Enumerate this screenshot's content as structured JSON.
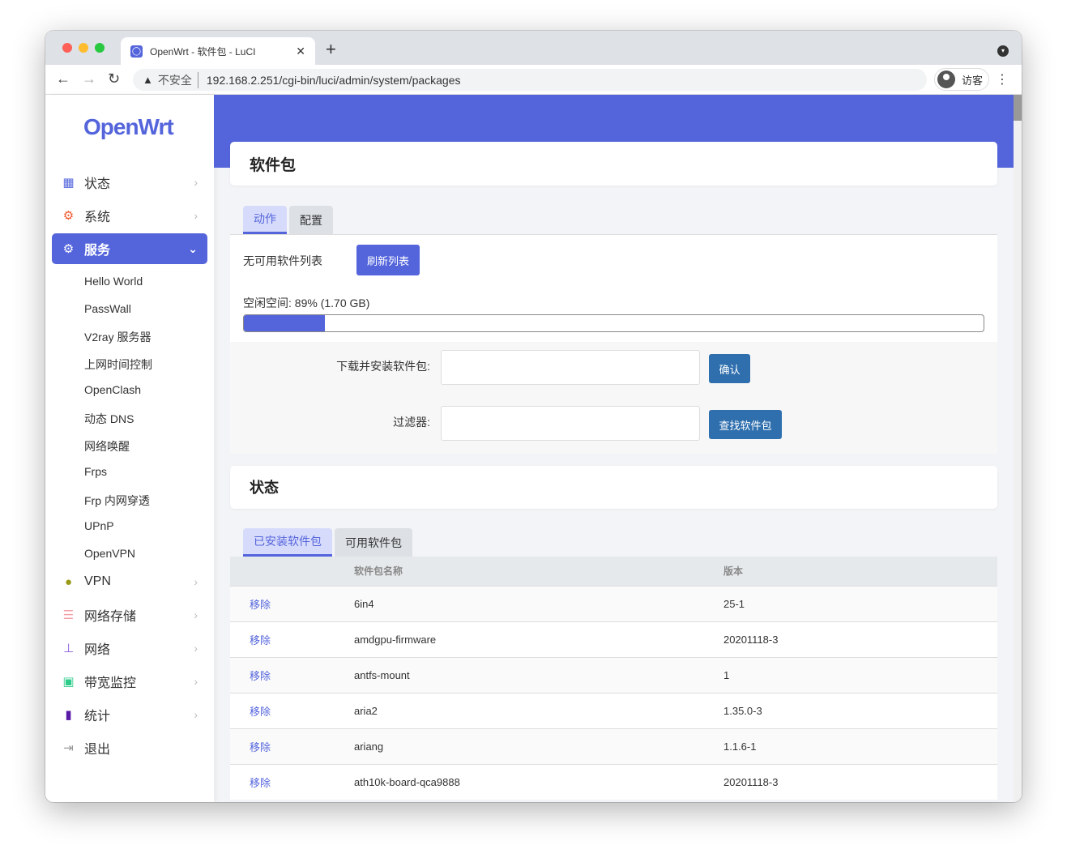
{
  "browser": {
    "tab_title": "OpenWrt - 软件包 - LuCI",
    "favicon": "openwrt-icon",
    "insecure_label": "不安全",
    "url": "192.168.2.251/cgi-bin/luci/admin/system/packages",
    "profile": "访客"
  },
  "sidebar": {
    "logo": "OpenWrt",
    "items": [
      {
        "label": "状态",
        "icon": "dashboard-icon",
        "color": "#5465dc"
      },
      {
        "label": "系统",
        "icon": "gear-icon",
        "color": "#f0582e"
      },
      {
        "label": "服务",
        "icon": "cogs-icon",
        "color": "#ffffff"
      },
      {
        "label": "VPN",
        "icon": "globe-lock-icon",
        "color": "#9a9a1a"
      },
      {
        "label": "网络存储",
        "icon": "database-icon",
        "color": "#f4a0aa"
      },
      {
        "label": "网络",
        "icon": "sitemap-icon",
        "color": "#8a5ce0"
      },
      {
        "label": "带宽监控",
        "icon": "monitor-icon",
        "color": "#2ecc8a"
      },
      {
        "label": "统计",
        "icon": "bar-chart-icon",
        "color": "#5a1aa8"
      },
      {
        "label": "退出",
        "icon": "logout-icon",
        "color": "#999999"
      }
    ],
    "services": [
      "Hello World",
      "PassWall",
      "V2ray 服务器",
      "上网时间控制",
      "OpenClash",
      "动态 DNS",
      "网络唤醒",
      "Frps",
      "Frp 内网穿透",
      "UPnP",
      "OpenVPN"
    ]
  },
  "page": {
    "title": "软件包",
    "tabs": [
      "动作",
      "配置"
    ],
    "no_list": "无可用软件列表",
    "refresh": "刷新列表",
    "free_space": "空闲空间: 89% (1.70 GB)",
    "used_fraction": 0.11,
    "install_label": "下载并安装软件包:",
    "install_value": "",
    "confirm": "确认",
    "filter_label": "过滤器:",
    "filter_value": "",
    "find": "查找软件包"
  },
  "status": {
    "title": "状态",
    "tabs": [
      "已安装软件包",
      "可用软件包"
    ],
    "headers": [
      "",
      "软件包名称",
      "版本"
    ],
    "rows": [
      {
        "action": "移除",
        "name": "6in4",
        "version": "25-1"
      },
      {
        "action": "移除",
        "name": "amdgpu-firmware",
        "version": "20201118-3"
      },
      {
        "action": "移除",
        "name": "antfs-mount",
        "version": "1"
      },
      {
        "action": "移除",
        "name": "aria2",
        "version": "1.35.0-3"
      },
      {
        "action": "移除",
        "name": "ariang",
        "version": "1.1.6-1"
      },
      {
        "action": "移除",
        "name": "ath10k-board-qca9888",
        "version": "20201118-3"
      }
    ]
  }
}
